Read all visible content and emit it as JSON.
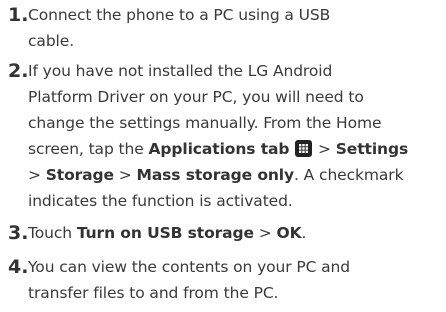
{
  "steps": [
    {
      "number": "1.",
      "lines": [
        [
          "Connect the phone to a PC using a USB"
        ],
        [
          "cable."
        ]
      ]
    },
    {
      "number": "2.",
      "lines": [
        [
          "If you have not installed the LG Android"
        ],
        [
          "Platform Driver on your PC, you will need to"
        ],
        [
          "change the settings manually. From the Home"
        ],
        [
          "screen, tap the ",
          "Applications tab",
          " ",
          ">",
          " ",
          "Settings"
        ],
        [
          ">",
          " ",
          "Storage",
          " > ",
          "Mass storage only",
          ". A checkmark"
        ],
        [
          "indicates the function is activated."
        ]
      ]
    },
    {
      "number": "3.",
      "lines": [
        [
          "Touch ",
          "Turn on USB storage",
          " > ",
          "OK",
          "."
        ]
      ]
    },
    {
      "number": "4.",
      "lines": [
        [
          "You can view the contents on your PC and"
        ],
        [
          "transfer files to and from the PC."
        ]
      ]
    }
  ],
  "icons": {
    "applications_tab": "applications-grid-icon"
  }
}
